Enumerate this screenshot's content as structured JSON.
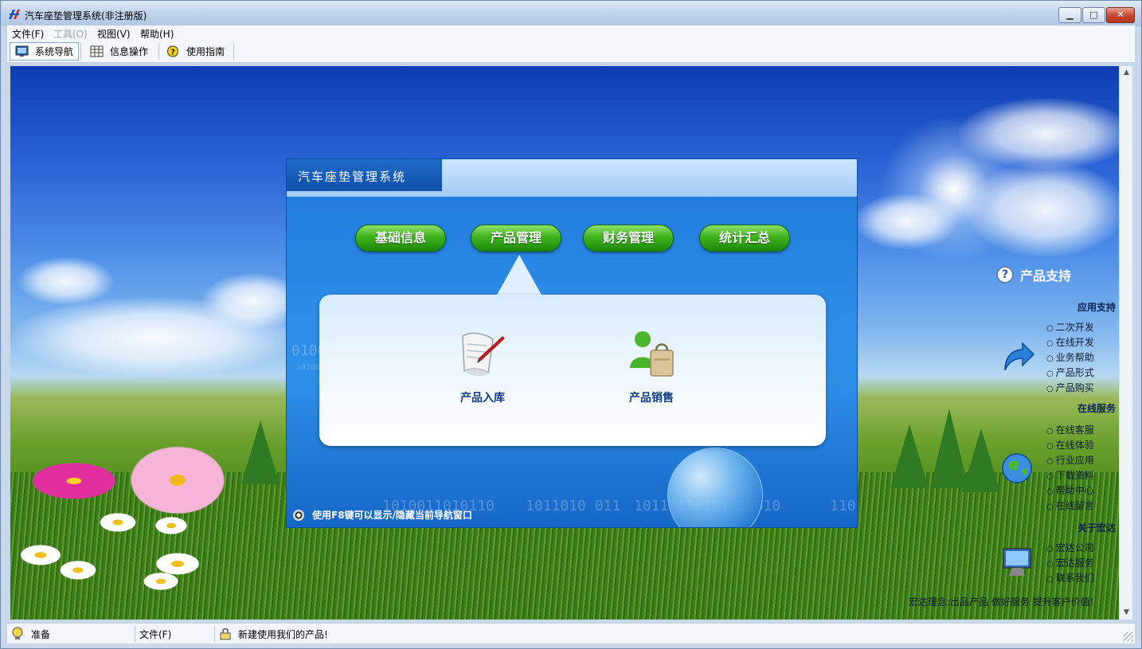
{
  "window": {
    "title": "汽车座垫管理系统(非注册版)",
    "controls": {
      "minimize": "▁",
      "maximize": "□",
      "close": "✕"
    }
  },
  "menu": {
    "items": [
      {
        "label": "文件(F)",
        "enabled": true
      },
      {
        "label": "工具(O)",
        "enabled": false
      },
      {
        "label": "视图(V)",
        "enabled": true
      },
      {
        "label": "帮助(H)",
        "enabled": true
      }
    ]
  },
  "toolbar": {
    "buttons": [
      {
        "label": "系统导航",
        "icon": "monitor-icon",
        "active": true
      },
      {
        "label": "信息操作",
        "icon": "grid-icon",
        "active": false
      },
      {
        "label": "使用指南",
        "icon": "help-icon",
        "active": false
      }
    ]
  },
  "panel": {
    "title": "汽车座垫管理系统",
    "tabs": [
      {
        "label": "基础信息"
      },
      {
        "label": "产品管理"
      },
      {
        "label": "财务管理"
      },
      {
        "label": "统计汇总"
      }
    ],
    "selected_tab": "产品管理",
    "items": [
      {
        "label": "产品入库",
        "icon": "scroll-pen-icon"
      },
      {
        "label": "产品销售",
        "icon": "person-bag-icon"
      }
    ],
    "binary_text": [
      "0100",
      "10100",
      "1010011010110",
      "1011010 011",
      "10110110101 10010",
      "110"
    ],
    "footer_hint": "使用F8键可以显示/隐藏当前导航窗口"
  },
  "sidebar": {
    "title": "产品支持",
    "sections": [
      {
        "heading": "应用支持",
        "links": [
          "二次开发",
          "在线开发",
          "业务帮助",
          "产品形式",
          "产品购买"
        ]
      },
      {
        "heading": "在线服务",
        "links": [
          "在线客服",
          "在线体验",
          "行业应用",
          "下载资料",
          "帮助中心",
          "在线留言"
        ]
      },
      {
        "heading": "关于宏达",
        "links": [
          "宏达公司",
          "宏达服务",
          "联系我们"
        ]
      }
    ],
    "slogan": "宏达理念:出品产品 做好服务 提升客户价值!"
  },
  "statusbar": {
    "status": "准备",
    "middle": "文件(F)",
    "message": "新建使用我们的产品!"
  }
}
